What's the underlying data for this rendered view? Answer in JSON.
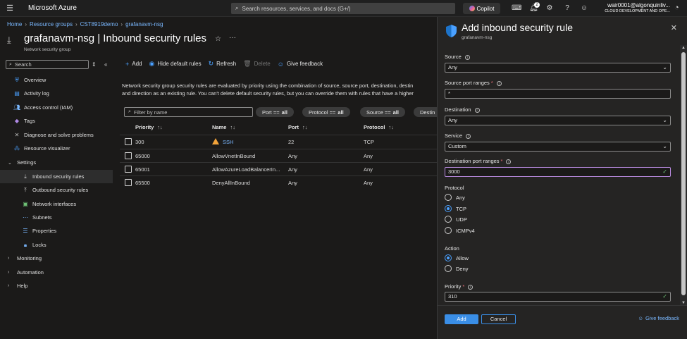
{
  "topbar": {
    "brand": "Microsoft Azure",
    "search_placeholder": "Search resources, services, and docs (G+/)",
    "copilot_label": "Copilot",
    "notification_count": "2",
    "account_email": "wair0001@algonquinliv...",
    "account_org": "CLOUD DEVELOPMENT AND OPE..."
  },
  "breadcrumb": [
    "Home",
    "Resource groups",
    "CST8919demo",
    "grafanavm-nsg"
  ],
  "header": {
    "title": "grafanavm-nsg | Inbound security rules",
    "subtitle": "Network security group"
  },
  "sidebar": {
    "search_placeholder": "Search",
    "items": [
      {
        "label": "Overview",
        "icon": "shield-icon"
      },
      {
        "label": "Activity log",
        "icon": "log-icon"
      },
      {
        "label": "Access control (IAM)",
        "icon": "people-icon"
      },
      {
        "label": "Tags",
        "icon": "tag-icon"
      },
      {
        "label": "Diagnose and solve problems",
        "icon": "wrench-icon"
      },
      {
        "label": "Resource visualizer",
        "icon": "network-icon"
      },
      {
        "label": "Settings",
        "icon": ""
      },
      {
        "label": "Inbound security rules",
        "icon": "inbound-icon"
      },
      {
        "label": "Outbound security rules",
        "icon": "outbound-icon"
      },
      {
        "label": "Network interfaces",
        "icon": "nic-icon"
      },
      {
        "label": "Subnets",
        "icon": "subnet-icon"
      },
      {
        "label": "Properties",
        "icon": "properties-icon"
      },
      {
        "label": "Locks",
        "icon": "lock-icon"
      },
      {
        "label": "Monitoring",
        "icon": ""
      },
      {
        "label": "Automation",
        "icon": ""
      },
      {
        "label": "Help",
        "icon": ""
      }
    ]
  },
  "toolbar": {
    "add": "Add",
    "hide_defaults": "Hide default rules",
    "refresh": "Refresh",
    "delete": "Delete",
    "feedback": "Give feedback"
  },
  "description": {
    "line1": "Network security group security rules are evaluated by priority using the combination of source, source port, destination, destin",
    "line2": "and direction as an existing rule. You can't delete default security rules, but you can override them with rules that have a higher"
  },
  "filters": {
    "placeholder": "Filter by name",
    "port": {
      "label": "Port ==",
      "value": "all"
    },
    "protocol": {
      "label": "Protocol ==",
      "value": "all"
    },
    "source": {
      "label": "Source ==",
      "value": "all"
    },
    "destination": {
      "label": "Destin",
      "value": ""
    }
  },
  "table": {
    "headers": [
      "Priority",
      "Name",
      "Port",
      "Protocol"
    ],
    "rows": [
      {
        "priority": "300",
        "name": "SSH",
        "port": "22",
        "protocol": "TCP"
      },
      {
        "priority": "65000",
        "name": "AllowVnetInBound",
        "port": "Any",
        "protocol": "Any"
      },
      {
        "priority": "65001",
        "name": "AllowAzureLoadBalancerIn...",
        "port": "Any",
        "protocol": "Any"
      },
      {
        "priority": "65500",
        "name": "DenyAllInBound",
        "port": "Any",
        "protocol": "Any"
      }
    ]
  },
  "panel": {
    "title": "Add inbound security rule",
    "subtitle": "grafanavm-nsg",
    "source_label": "Source",
    "source_value": "Any",
    "source_port_label": "Source port ranges",
    "source_port_value": "*",
    "destination_label": "Destination",
    "destination_value": "Any",
    "service_label": "Service",
    "service_value": "Custom",
    "dest_port_label": "Destination port ranges",
    "dest_port_value": "3000",
    "protocol_label": "Protocol",
    "protocols": [
      "Any",
      "TCP",
      "UDP",
      "ICMPv4"
    ],
    "protocol_selected": "TCP",
    "action_label": "Action",
    "actions": [
      "Allow",
      "Deny"
    ],
    "action_selected": "Allow",
    "priority_label": "Priority",
    "priority_value": "310",
    "add_button": "Add",
    "cancel_button": "Cancel",
    "feedback": "Give feedback"
  },
  "colors": {
    "accent": "#3a8ee6",
    "link": "#7ab8ff",
    "warning": "#f2a33a",
    "required": "#f1707b",
    "valid": "#6fc276"
  }
}
